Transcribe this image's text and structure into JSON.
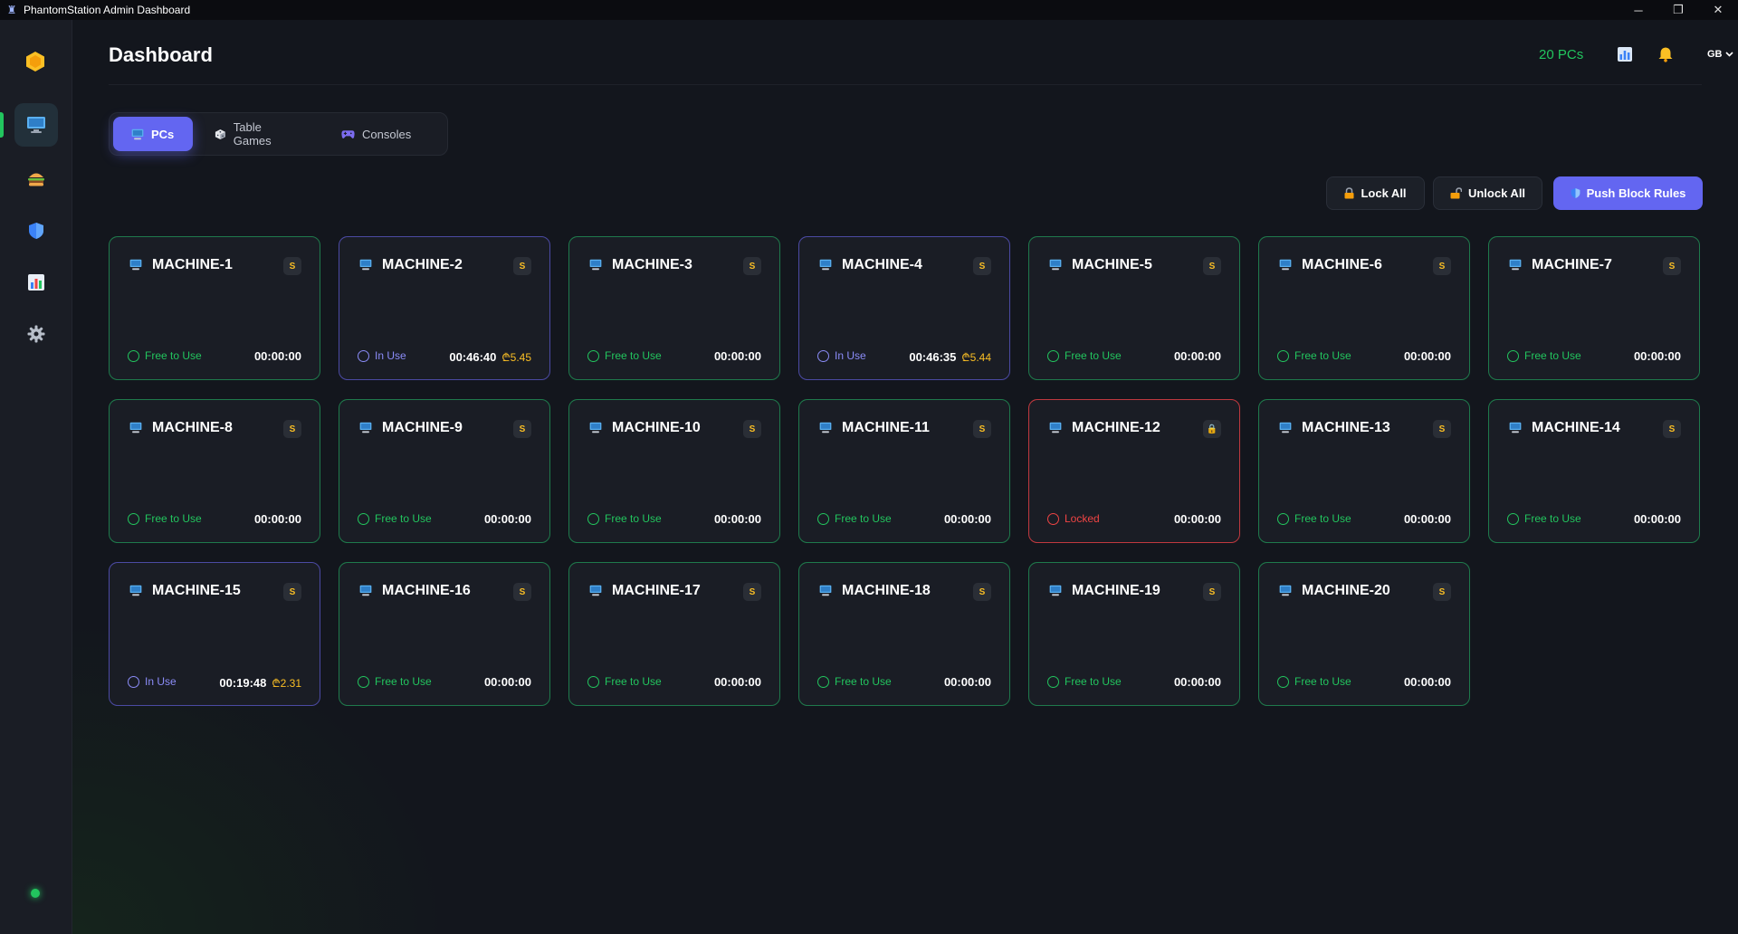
{
  "window": {
    "title": "PhantomStation Admin Dashboard",
    "minimize": "─",
    "restore": "❐",
    "close": "✕"
  },
  "colors": {
    "accent": "#6366f1",
    "free": "#22c55e",
    "in_use": "#8b8cf8",
    "locked": "#ef4444",
    "cost": "#fbbf24"
  },
  "sidebar": {
    "items": [
      {
        "icon": "monitor-icon",
        "active": true
      },
      {
        "icon": "burger-icon",
        "active": false
      },
      {
        "icon": "shield-icon",
        "active": false
      },
      {
        "icon": "chart-icon",
        "active": false
      },
      {
        "icon": "gear-icon",
        "active": false
      }
    ]
  },
  "header": {
    "title": "Dashboard",
    "pc_count": "20 PCs",
    "language": "GB"
  },
  "tabs": [
    {
      "label": "PCs",
      "icon": "monitor-icon",
      "active": true
    },
    {
      "label": "Table Games",
      "icon": "dice-icon",
      "active": false
    },
    {
      "label": "Consoles",
      "icon": "gamepad-icon",
      "active": false
    }
  ],
  "actions": {
    "lock_all": "Lock All",
    "unlock_all": "Unlock All",
    "push_block_rules": "Push Block Rules"
  },
  "machines": [
    {
      "name": "MACHINE-1",
      "badge": "S",
      "status": "Free to Use",
      "state": "free",
      "time": "00:00:00",
      "cost": ""
    },
    {
      "name": "MACHINE-2",
      "badge": "S",
      "status": "In Use",
      "state": "inuse",
      "time": "00:46:40",
      "cost": "₾5.45"
    },
    {
      "name": "MACHINE-3",
      "badge": "S",
      "status": "Free to Use",
      "state": "free",
      "time": "00:00:00",
      "cost": ""
    },
    {
      "name": "MACHINE-4",
      "badge": "S",
      "status": "In Use",
      "state": "inuse",
      "time": "00:46:35",
      "cost": "₾5.44"
    },
    {
      "name": "MACHINE-5",
      "badge": "S",
      "status": "Free to Use",
      "state": "free",
      "time": "00:00:00",
      "cost": ""
    },
    {
      "name": "MACHINE-6",
      "badge": "S",
      "status": "Free to Use",
      "state": "free",
      "time": "00:00:00",
      "cost": ""
    },
    {
      "name": "MACHINE-7",
      "badge": "S",
      "status": "Free to Use",
      "state": "free",
      "time": "00:00:00",
      "cost": ""
    },
    {
      "name": "MACHINE-8",
      "badge": "S",
      "status": "Free to Use",
      "state": "free",
      "time": "00:00:00",
      "cost": ""
    },
    {
      "name": "MACHINE-9",
      "badge": "S",
      "status": "Free to Use",
      "state": "free",
      "time": "00:00:00",
      "cost": ""
    },
    {
      "name": "MACHINE-10",
      "badge": "S",
      "status": "Free to Use",
      "state": "free",
      "time": "00:00:00",
      "cost": ""
    },
    {
      "name": "MACHINE-11",
      "badge": "S",
      "status": "Free to Use",
      "state": "free",
      "time": "00:00:00",
      "cost": ""
    },
    {
      "name": "MACHINE-12",
      "badge": "🔒",
      "status": "Locked",
      "state": "locked",
      "time": "00:00:00",
      "cost": ""
    },
    {
      "name": "MACHINE-13",
      "badge": "S",
      "status": "Free to Use",
      "state": "free",
      "time": "00:00:00",
      "cost": ""
    },
    {
      "name": "MACHINE-14",
      "badge": "S",
      "status": "Free to Use",
      "state": "free",
      "time": "00:00:00",
      "cost": ""
    },
    {
      "name": "MACHINE-15",
      "badge": "S",
      "status": "In Use",
      "state": "inuse",
      "time": "00:19:48",
      "cost": "₾2.31"
    },
    {
      "name": "MACHINE-16",
      "badge": "S",
      "status": "Free to Use",
      "state": "free",
      "time": "00:00:00",
      "cost": ""
    },
    {
      "name": "MACHINE-17",
      "badge": "S",
      "status": "Free to Use",
      "state": "free",
      "time": "00:00:00",
      "cost": ""
    },
    {
      "name": "MACHINE-18",
      "badge": "S",
      "status": "Free to Use",
      "state": "free",
      "time": "00:00:00",
      "cost": ""
    },
    {
      "name": "MACHINE-19",
      "badge": "S",
      "status": "Free to Use",
      "state": "free",
      "time": "00:00:00",
      "cost": ""
    },
    {
      "name": "MACHINE-20",
      "badge": "S",
      "status": "Free to Use",
      "state": "free",
      "time": "00:00:00",
      "cost": ""
    }
  ]
}
